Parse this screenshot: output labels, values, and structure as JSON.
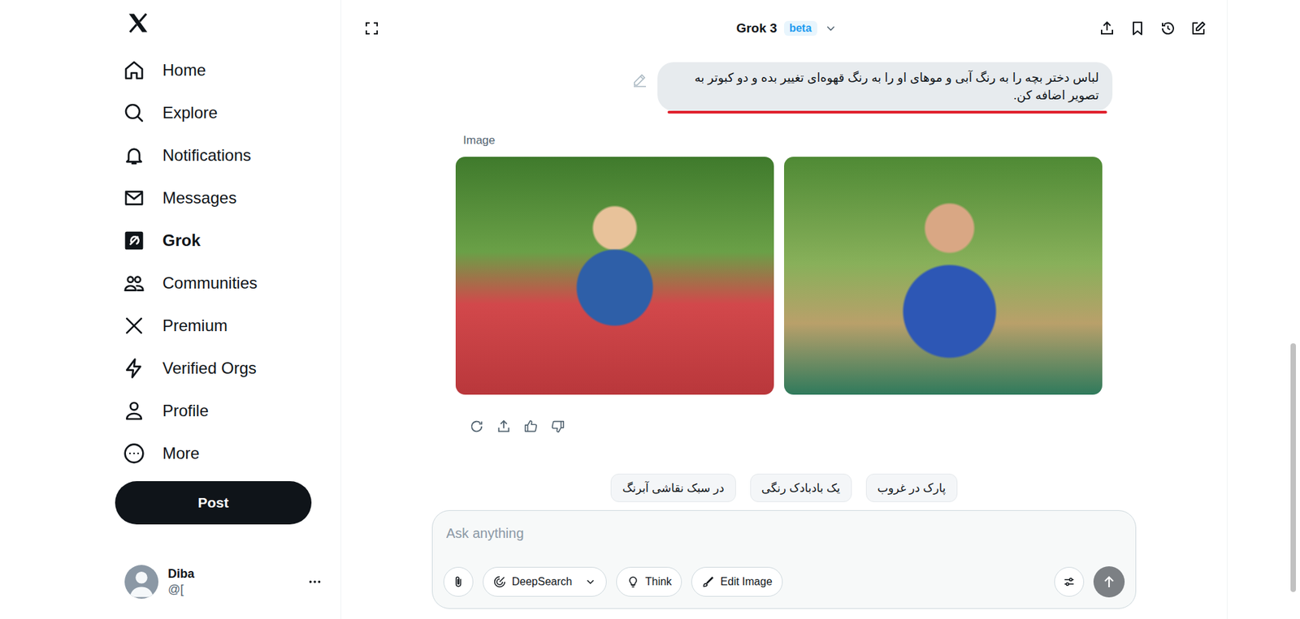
{
  "sidebar": {
    "items": [
      {
        "label": "Home",
        "selected": false
      },
      {
        "label": "Explore",
        "selected": false
      },
      {
        "label": "Notifications",
        "selected": false
      },
      {
        "label": "Messages",
        "selected": false
      },
      {
        "label": "Grok",
        "selected": true
      },
      {
        "label": "Communities",
        "selected": false
      },
      {
        "label": "Premium",
        "selected": false
      },
      {
        "label": "Verified Orgs",
        "selected": false
      },
      {
        "label": "Profile",
        "selected": false
      },
      {
        "label": "More",
        "selected": false
      }
    ],
    "post_button": "Post",
    "account": {
      "name": "Diba",
      "handle": "@["
    }
  },
  "header": {
    "model": "Grok 3",
    "badge": "beta"
  },
  "conversation": {
    "user_message": "لباس دختر بچه را به رنگ آبی و موهای او را به رنگ قهوه‌ای تغییر بده و دو کبوتر به تصویر اضافه کن.",
    "underlined": true,
    "result_label": "Image",
    "images": [
      {
        "kind": "photo"
      },
      {
        "kind": "photo"
      }
    ]
  },
  "suggestions": [
    "در سبک نقاشی آبرنگ",
    "یک بادبادک رنگی",
    "پارک در غروب"
  ],
  "composer": {
    "placeholder": "Ask anything",
    "tools": [
      {
        "label": "DeepSearch",
        "kind": "dropdown",
        "selected": false
      },
      {
        "label": "Think",
        "kind": "toggle",
        "selected": false
      },
      {
        "label": "Edit Image",
        "kind": "toggle",
        "selected": false
      }
    ]
  }
}
